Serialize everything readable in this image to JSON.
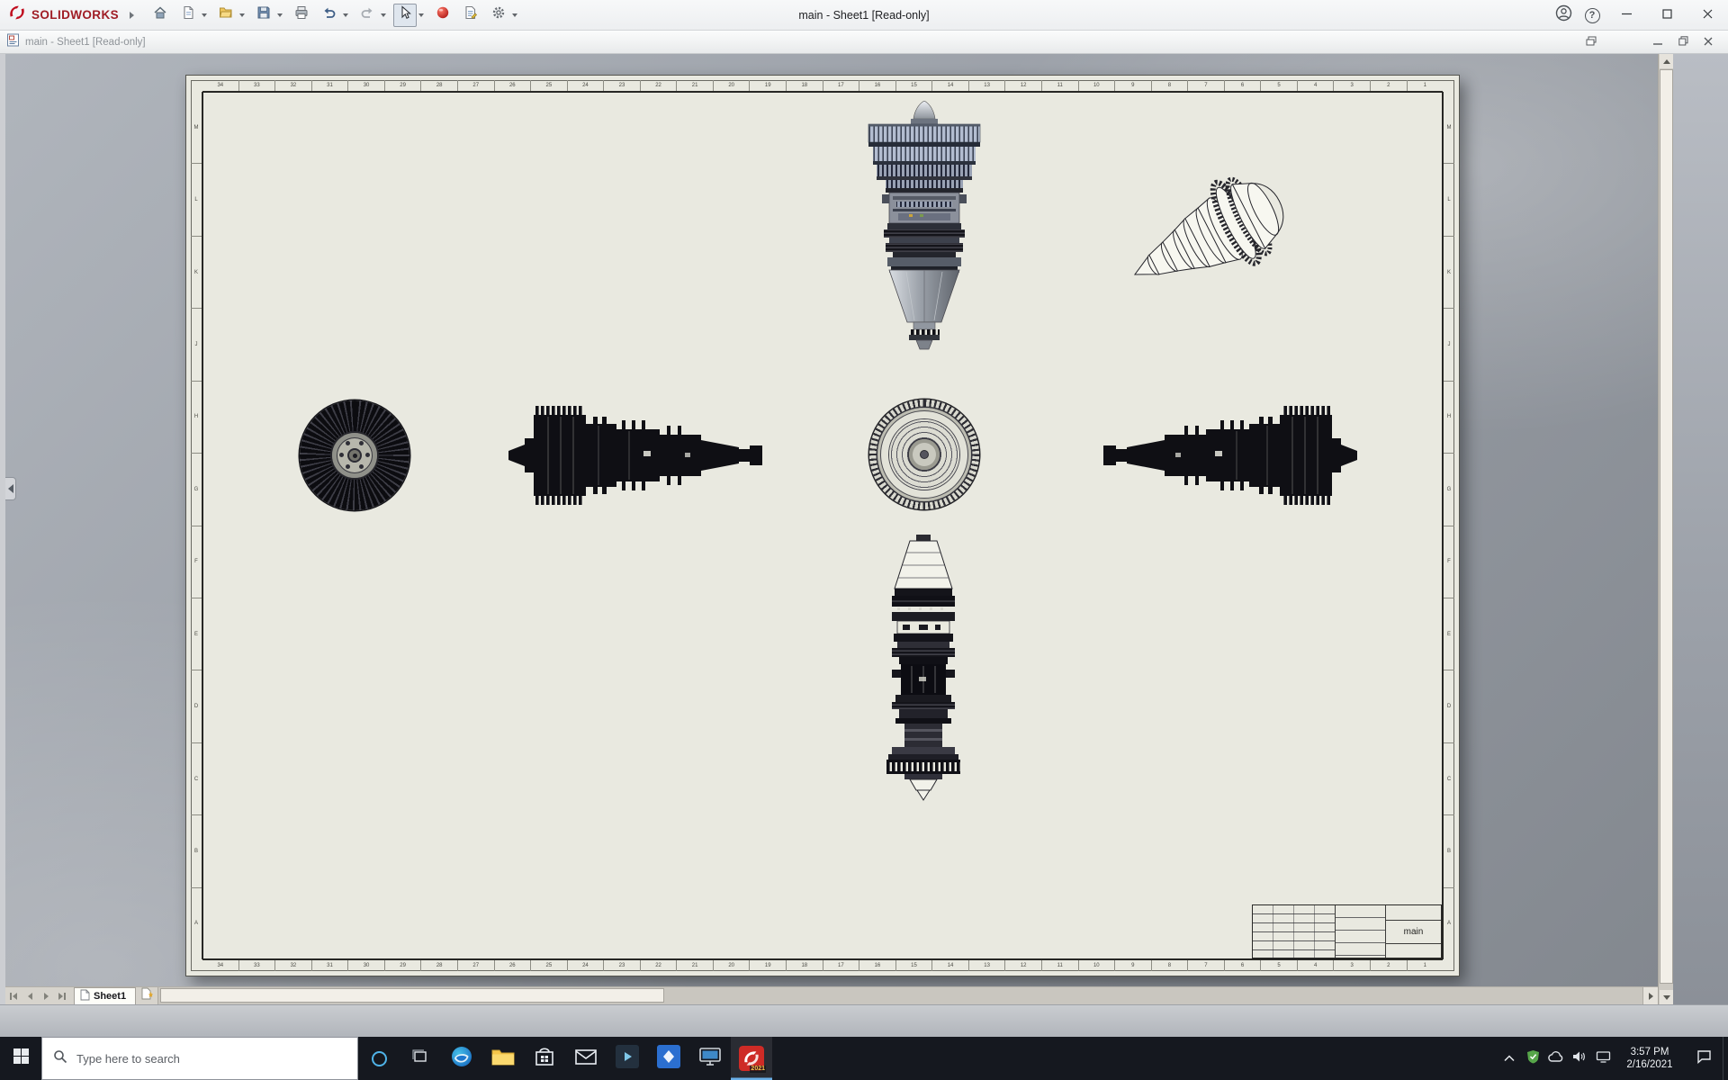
{
  "titlebar": {
    "brand": "SOLIDWORKS",
    "title": "main - Sheet1 [Read-only]",
    "help_glyph": "?"
  },
  "childbar": {
    "title": "main - Sheet1 [Read-only]"
  },
  "sheet_tabs": {
    "active_tab": "Sheet1"
  },
  "title_block": {
    "drawing_name": "main"
  },
  "zones": {
    "columns": [
      "34",
      "33",
      "32",
      "31",
      "30",
      "29",
      "28",
      "27",
      "26",
      "25",
      "24",
      "23",
      "22",
      "21",
      "20",
      "19",
      "18",
      "17",
      "16",
      "15",
      "14",
      "13",
      "12",
      "11",
      "10",
      "9",
      "8",
      "7",
      "6",
      "5",
      "4",
      "3",
      "2",
      "1"
    ],
    "rows": [
      "M",
      "L",
      "K",
      "J",
      "H",
      "G",
      "F",
      "E",
      "D",
      "C",
      "B",
      "A"
    ]
  },
  "taskbar": {
    "search_placeholder": "Type here to search",
    "time": "3:57 PM",
    "date": "2/16/2021",
    "solidworks_badge": "2021"
  },
  "icons": {
    "toolbar": [
      "home",
      "new-document",
      "open-folder",
      "save",
      "print",
      "undo",
      "redo",
      "select-cursor",
      "red-sphere",
      "file-properties",
      "options-gear"
    ],
    "titlebar_right": [
      "user-account",
      "help",
      "minimize",
      "maximize",
      "close"
    ],
    "child_controls": [
      "tile-windows",
      "minimize",
      "restore",
      "close"
    ],
    "taskbar": [
      "start",
      "search",
      "cortana",
      "task-view",
      "edge-browser",
      "file-explorer",
      "store",
      "mail",
      "media-app",
      "blue-app",
      "monitor-app",
      "solidworks"
    ],
    "tray": [
      "hidden-icons-chevron",
      "shield",
      "cloud",
      "volume",
      "network",
      "action-center"
    ],
    "help_unicode": "?"
  }
}
